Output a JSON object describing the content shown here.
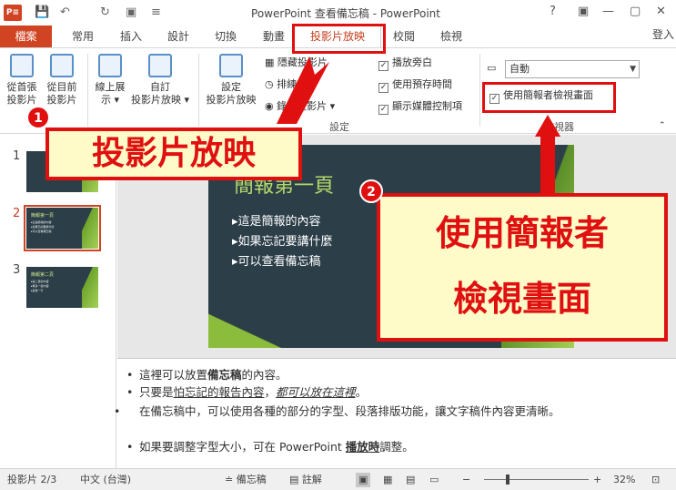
{
  "window": {
    "title": "PowerPoint 查看備忘稿 - PowerPoint",
    "app_icon": "P≡",
    "help": "?",
    "minimize": "—",
    "restore": "▢",
    "close": "✕"
  },
  "qat": {
    "save": "💾",
    "undo": "↶",
    "redo": "↻",
    "present": "▣",
    "more": "≡"
  },
  "tabs": {
    "file": "檔案",
    "home": "常用",
    "insert": "插入",
    "design": "設計",
    "transitions": "切換",
    "animations": "動畫",
    "slideshow": "投影片放映",
    "review": "校閱",
    "view": "檢視",
    "login": "登入"
  },
  "ribbon": {
    "from_start": "從首張\n投影片",
    "from_current": "從目前\n投影片",
    "online": "線上展\n示 ▾",
    "custom": "自訂\n投影片放映 ▾",
    "setup": "設定\n投影片放映",
    "hide_slide": "隱藏投影片",
    "rehearse": "排練計時",
    "record": "錄製投影片 ▾",
    "play_narration": "播放旁白",
    "use_timings": "使用預存時間",
    "show_media": "顯示媒體控制項",
    "group_setup": "設定",
    "monitor_value": "自動",
    "presenter_view": "使用簡報者檢視畫面",
    "group_monitor": "監視器"
  },
  "slides": [
    {
      "num": "1"
    },
    {
      "num": "2",
      "title": "簡報第一頁",
      "lines": "▸這是簡報的內容\n▸如果忘記要講什麼\n▸可以查看備忘稿"
    },
    {
      "num": "3",
      "title": "簡報第二頁",
      "lines": "▸第二頁的內容\n▸再多一些內容\n▸最後一行"
    }
  ],
  "current_slide": {
    "title": "簡報第一頁",
    "bullets": [
      "▸這是簡報的內容",
      "▸如果忘記要講什麼",
      "▸可以查看備忘稿"
    ]
  },
  "notes": [
    {
      "pre": "這裡可以放置",
      "bold": "備忘稿",
      "post": "的內容。"
    },
    {
      "pre": "只要是",
      "u1": "怕忘記的報告內容",
      "sep": "，",
      "italic": "都可以放在這裡",
      "post": "。"
    },
    {
      "text": "在備忘稿中，可以使用各種的部分的字型、段落排版功能，讓文字稿件內容更清晰。"
    },
    {
      "pre": "如果要調整字型大小，可在 PowerPoint ",
      "bold": "播放時",
      "post": "調整。"
    }
  ],
  "status": {
    "slide_info": "投影片 2/3",
    "language": "中文 (台灣)",
    "notes_btn": "≐ 備忘稿",
    "comments_btn": "▤ 註解",
    "zoom_minus": "−",
    "zoom_plus": "+",
    "zoom": "32%",
    "fit": "⊡"
  },
  "callouts": {
    "one_num": "1",
    "one_text": "投影片放映",
    "two_num": "2",
    "two_text": "使用簡報者\n檢視畫面"
  },
  "colors": {
    "accent": "#d04423",
    "callout_red": "#e01010",
    "callout_bg": "#fffbc8"
  }
}
